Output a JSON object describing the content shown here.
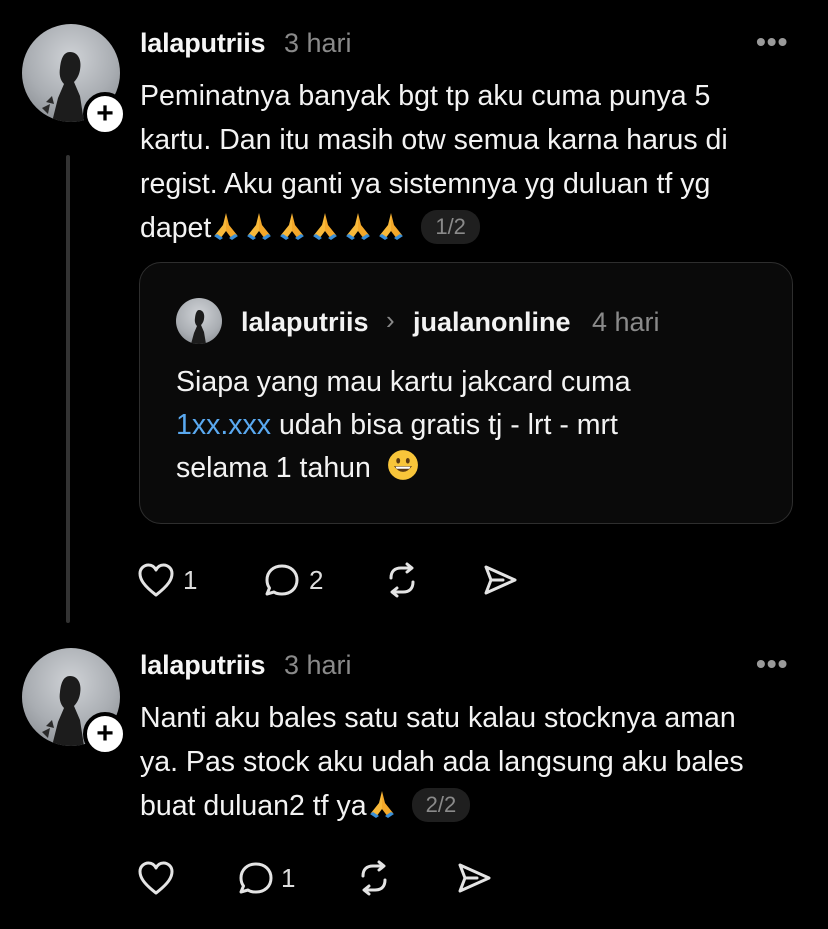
{
  "posts": [
    {
      "username": "lalaputriis",
      "time": "3 hari",
      "more": "•••",
      "lines": [
        "Peminatnya banyak bgt tp aku cuma punya 5",
        "kartu. Dan itu masih otw semua karna harus di",
        "regist. Aku ganti ya sistemnya yg duluan tf yg",
        "dapet"
      ],
      "emoji_name": "folded-hands",
      "emoji_count": 6,
      "page_indicator": "1/2",
      "quote": {
        "username": "lalaputriis",
        "separator": "›",
        "reply_to": "jualanonline",
        "time": "4 hari",
        "line1": "Siapa yang mau kartu jakcard cuma",
        "link": "1xx.xxx",
        "line2_rest": " udah bisa gratis tj - lrt - mrt",
        "line3": "selama 1 tahun",
        "emoji_name": "grinning-face"
      },
      "likes": "1",
      "replies": "2"
    },
    {
      "username": "lalaputriis",
      "time": "3 hari",
      "more": "•••",
      "lines": [
        "Nanti aku bales satu satu kalau stocknya aman",
        "ya. Pas stock aku udah ada langsung aku bales",
        "buat duluan2 tf ya"
      ],
      "emoji_name": "folded-hands",
      "emoji_count": 1,
      "page_indicator": "2/2",
      "likes": "",
      "replies": "1"
    }
  ],
  "colors": {
    "background": "#000000",
    "text": "#f3f3f3",
    "muted": "#8a8a8a",
    "link": "#5aa9f0",
    "border": "#2e2e2e"
  }
}
